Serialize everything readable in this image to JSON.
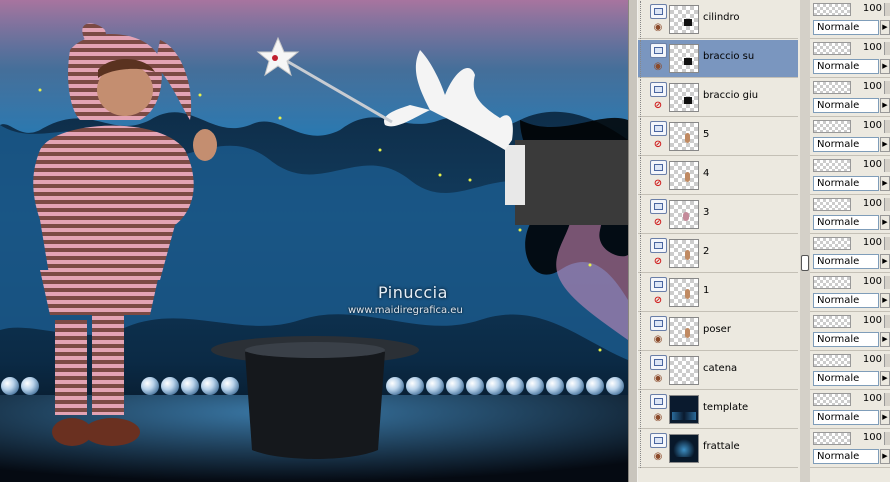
{
  "canvas": {
    "watermark_title": "Pinuccia",
    "watermark_url": "www.maidiregrafica.eu"
  },
  "colors": {
    "selected_row": "#7a96bf",
    "panel_bg": "#ece9e0",
    "fractal_blue": "#2e8fd0",
    "fractal_pink": "#d88fc0"
  },
  "layers": [
    {
      "name": "cilindro",
      "visible": true,
      "thumb": "black",
      "opacity": "100",
      "blend": "Normale",
      "selected": false
    },
    {
      "name": "braccio su",
      "visible": true,
      "thumb": "black",
      "opacity": "100",
      "blend": "Normale",
      "selected": true
    },
    {
      "name": "braccio giu",
      "visible": false,
      "thumb": "black",
      "opacity": "100",
      "blend": "Normale",
      "selected": false
    },
    {
      "name": "5",
      "visible": false,
      "thumb": "skin",
      "opacity": "100",
      "blend": "Normale",
      "selected": false
    },
    {
      "name": "4",
      "visible": false,
      "thumb": "skin",
      "opacity": "100",
      "blend": "Normale",
      "selected": false
    },
    {
      "name": "3",
      "visible": false,
      "thumb": "pink",
      "opacity": "100",
      "blend": "Normale",
      "selected": false
    },
    {
      "name": "2",
      "visible": false,
      "thumb": "skin",
      "opacity": "100",
      "blend": "Normale",
      "selected": false
    },
    {
      "name": "1",
      "visible": false,
      "thumb": "skin",
      "opacity": "100",
      "blend": "Normale",
      "selected": false
    },
    {
      "name": "poser",
      "visible": true,
      "thumb": "skin",
      "opacity": "100",
      "blend": "Normale",
      "selected": false
    },
    {
      "name": "catena",
      "visible": true,
      "thumb": "none",
      "opacity": "100",
      "blend": "Normale",
      "selected": false
    },
    {
      "name": "template",
      "visible": true,
      "thumb": "dark",
      "opacity": "100",
      "blend": "Normale",
      "selected": false
    },
    {
      "name": "frattale",
      "visible": true,
      "thumb": "fractal",
      "opacity": "100",
      "blend": "Normale",
      "selected": false
    }
  ]
}
